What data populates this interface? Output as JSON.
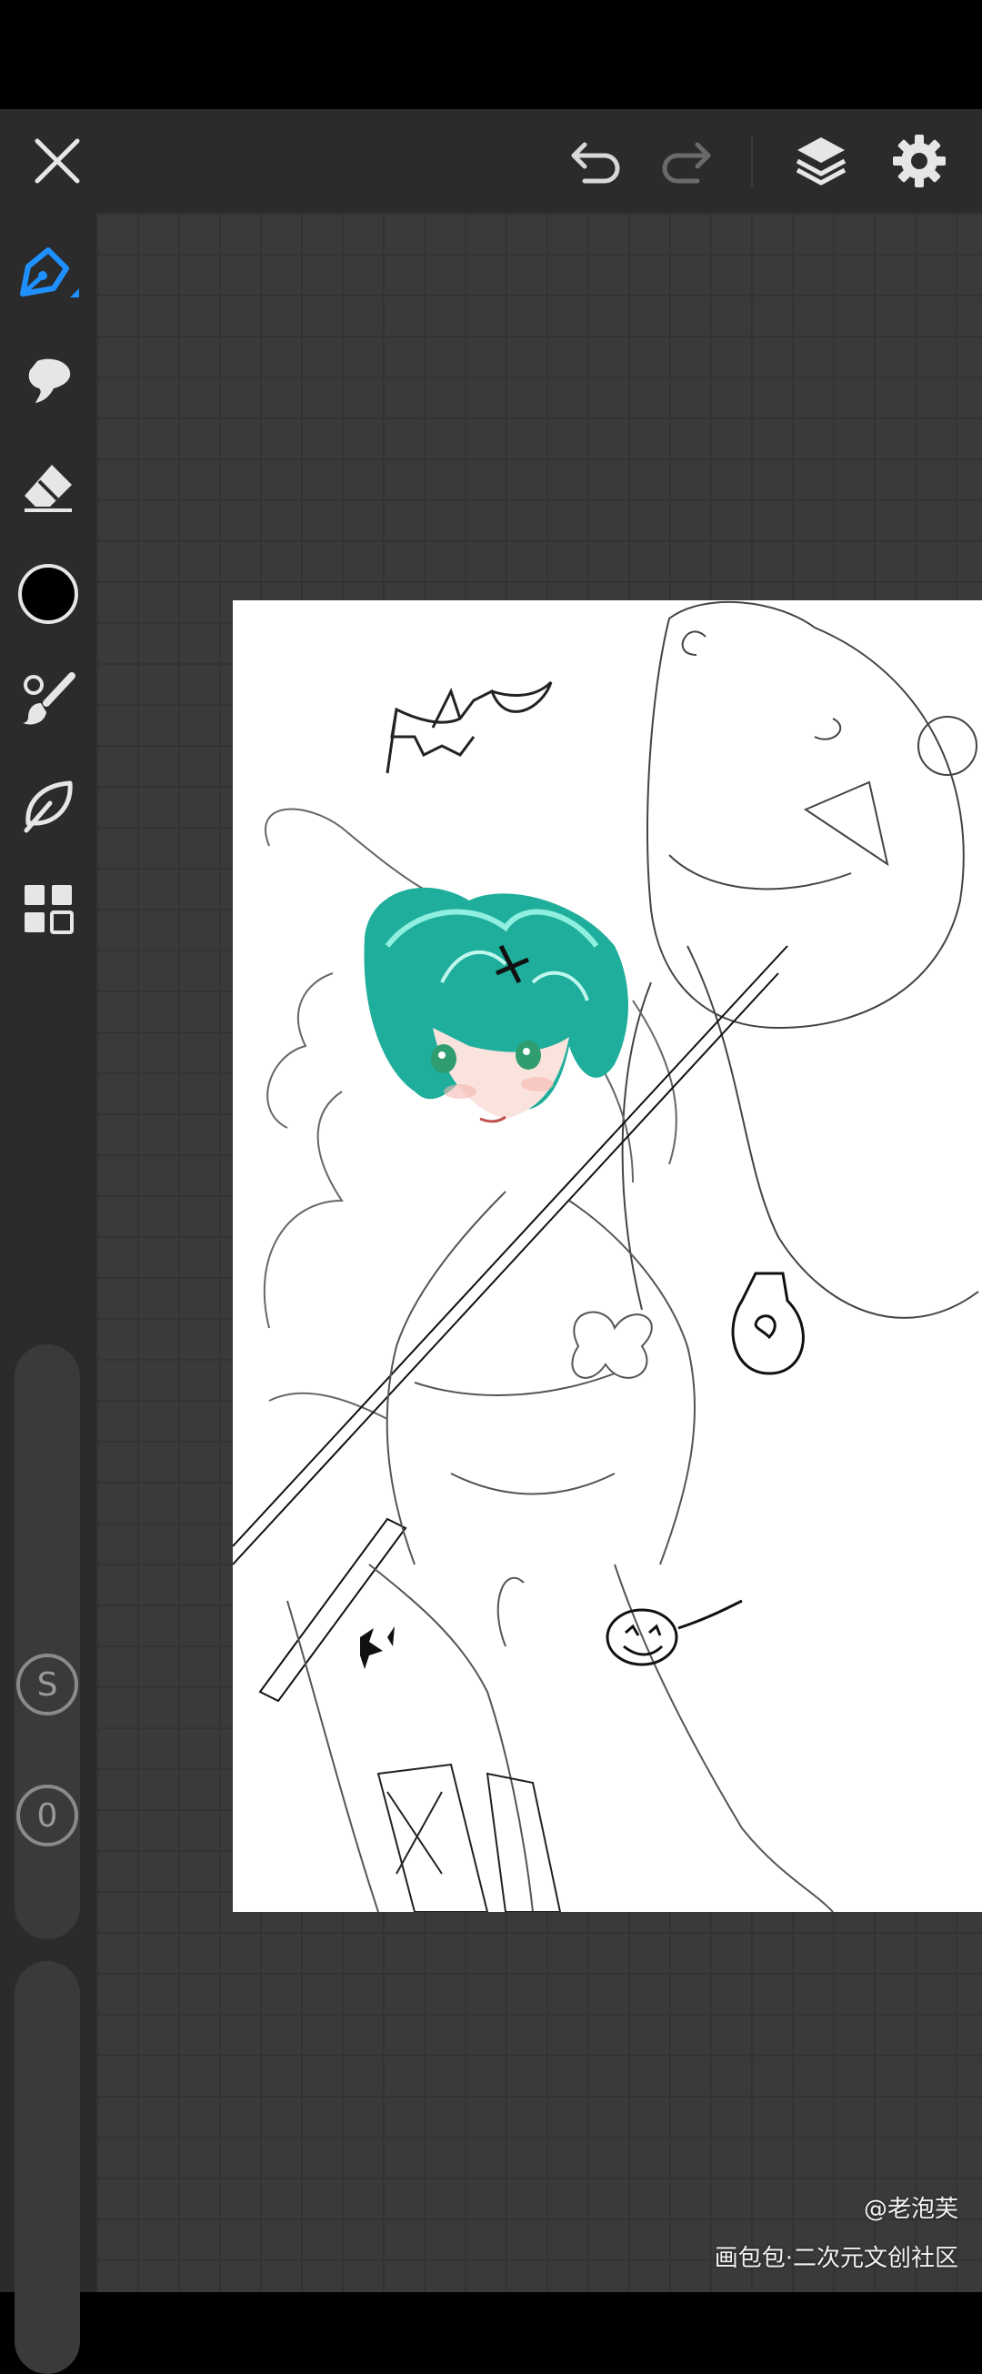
{
  "toolbar": {
    "close_icon": "close-icon",
    "undo_icon": "undo-icon",
    "redo_icon": "redo-icon",
    "layers_icon": "layers-icon",
    "settings_icon": "gear-icon"
  },
  "tools": [
    {
      "name": "pen",
      "icon": "pen-icon",
      "selected": true
    },
    {
      "name": "smudge",
      "icon": "smudge-icon"
    },
    {
      "name": "eraser",
      "icon": "eraser-icon"
    },
    {
      "name": "color",
      "icon": "color-swatch",
      "color": "#000000"
    },
    {
      "name": "brush",
      "icon": "brush-icon"
    },
    {
      "name": "lasso",
      "icon": "lasso-icon"
    },
    {
      "name": "more",
      "icon": "grid-icon"
    }
  ],
  "sliders": {
    "size_label": "S",
    "opacity_label": "0"
  },
  "colors": {
    "accent": "#1e90ff",
    "toolbar_bg": "#2b2b2b",
    "workspace_bg": "#3a3a3a"
  },
  "watermark": {
    "author": "@老泡芙",
    "site": "画包包·二次元文创社区"
  }
}
